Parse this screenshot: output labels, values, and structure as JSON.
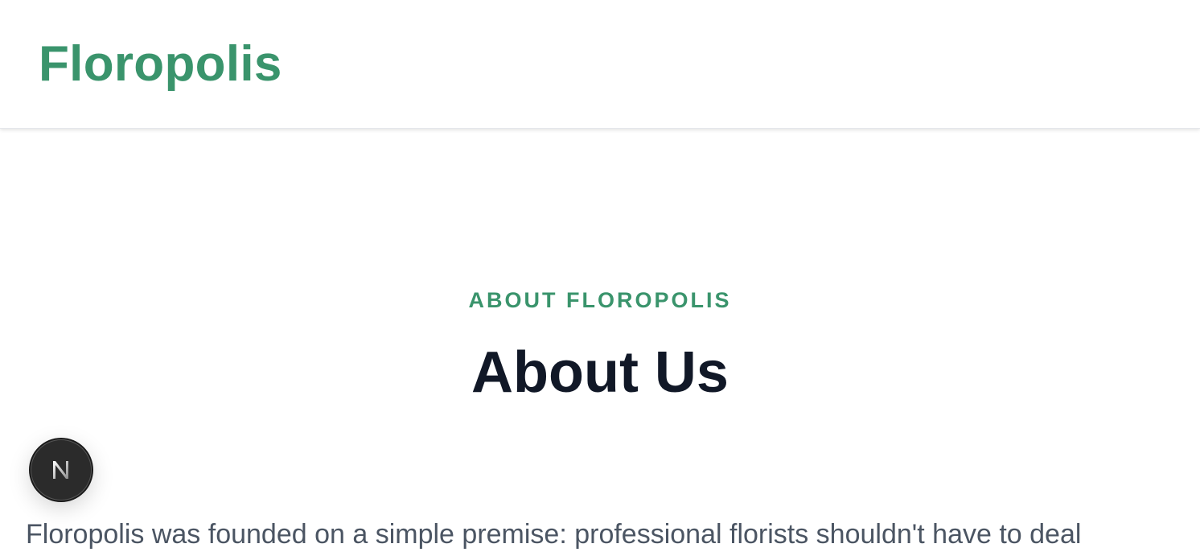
{
  "header": {
    "brand": "Floropolis",
    "brand_color": "#3a946c"
  },
  "hero": {
    "eyebrow": "ABOUT FLOROPOLIS",
    "title": "About Us",
    "intro": "Floropolis was founded on a simple premise: professional florists shouldn't have to deal"
  },
  "dev_badge": {
    "letter": "N",
    "icon": "nextjs-logo-icon"
  }
}
